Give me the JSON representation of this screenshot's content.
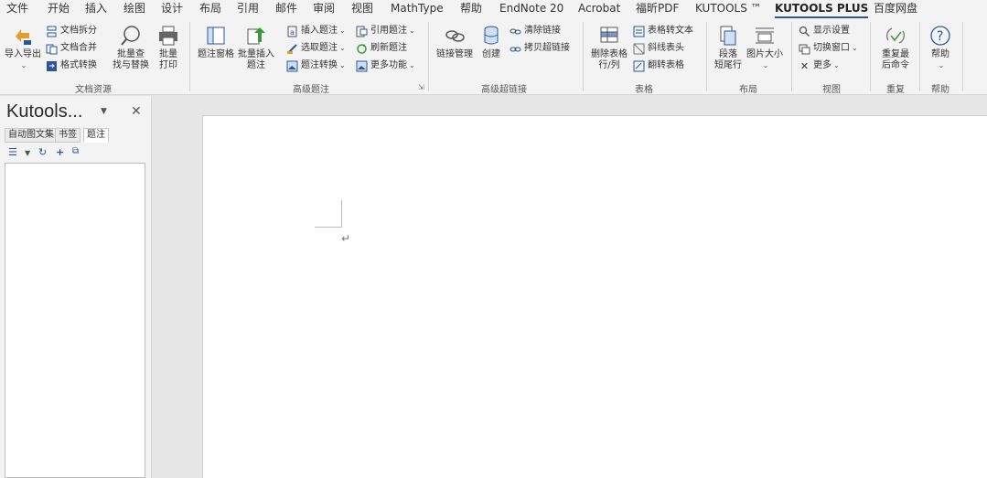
{
  "tabs": [
    "文件",
    "开始",
    "插入",
    "绘图",
    "设计",
    "布局",
    "引用",
    "邮件",
    "审阅",
    "视图",
    "MathType",
    "帮助",
    "EndNote 20",
    "Acrobat",
    "福昕PDF",
    "KUTOOLS ™",
    "KUTOOLS PLUS",
    "百度网盘"
  ],
  "active_tab": "KUTOOLS PLUS",
  "ribbon": {
    "doc": {
      "import_export": "导入导出",
      "split": "文档拆分",
      "merge": "文档合并",
      "format_convert": "格式转换",
      "batch_find": "批量查\n找与替换",
      "batch_print": "批量\n打印",
      "group": "文档资源"
    },
    "caption": {
      "pane": "题注窗格",
      "batch_insert": "批量插入\n题注",
      "insert": "插入题注",
      "select": "选取题注",
      "convert": "题注转换",
      "ref": "引用题注",
      "refresh": "刷新题注",
      "more": "更多功能",
      "group": "高级题注"
    },
    "link": {
      "manage": "链接管理",
      "create": "创建",
      "clear": "清除链接",
      "copy": "拷贝超链接",
      "group": "高级超链接"
    },
    "table": {
      "delete_rows": "删除表格\n行/列",
      "to_text": "表格转文本",
      "diagonal": "斜线表头",
      "flip": "翻转表格",
      "group": "表格"
    },
    "layout": {
      "para_end": "段落\n短尾行",
      "img_size": "图片大小",
      "group": "布局"
    },
    "view": {
      "display": "显示设置",
      "switch_window": "切换窗口",
      "more": "更多",
      "group": "视图"
    },
    "repeat": {
      "last": "重复最\n后命令",
      "group": "重复"
    },
    "help": {
      "help": "帮助",
      "group": "帮助"
    }
  },
  "pane": {
    "title": "Kutools...",
    "tabs": [
      "自动图文集",
      "书签",
      "题注"
    ],
    "active_tab": "题注"
  },
  "document": {
    "paragraph_mark": "↵"
  },
  "colors": {
    "accent": "#2b579a",
    "ribbon_bg": "#f3f3f3",
    "workspace_bg": "#e6e6e6"
  }
}
